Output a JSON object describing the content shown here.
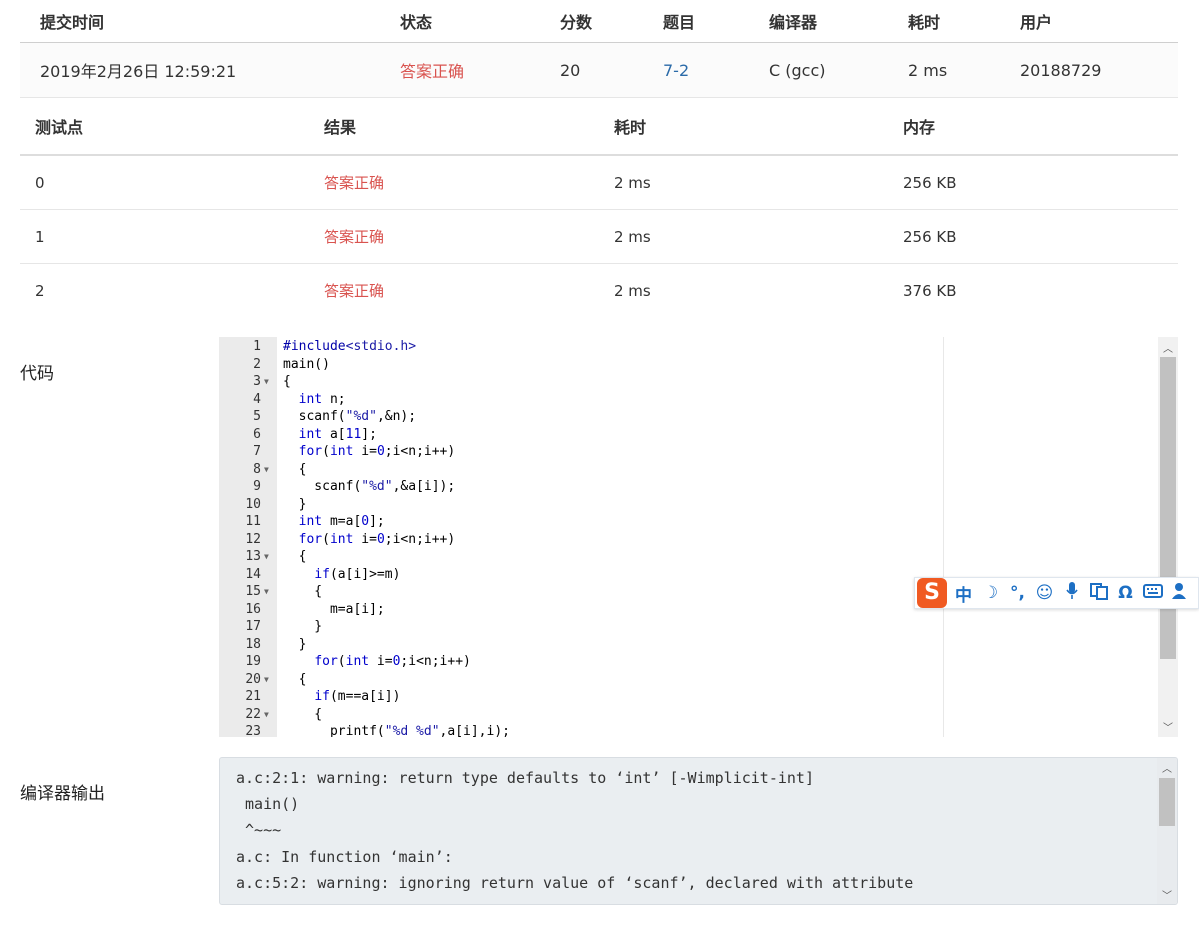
{
  "submission": {
    "headers": [
      "提交时间",
      "状态",
      "分数",
      "题目",
      "编译器",
      "耗时",
      "用户"
    ],
    "row": {
      "time": "2019年2月26日 12:59:21",
      "status": "答案正确",
      "score": "20",
      "problem": "7-2",
      "compiler": "C (gcc)",
      "elapsed": "2 ms",
      "user": "20188729"
    }
  },
  "testcases": {
    "headers": [
      "测试点",
      "结果",
      "耗时",
      "内存"
    ],
    "rows": [
      {
        "id": "0",
        "result": "答案正确",
        "time": "2 ms",
        "memory": "256 KB"
      },
      {
        "id": "1",
        "result": "答案正确",
        "time": "2 ms",
        "memory": "256 KB"
      },
      {
        "id": "2",
        "result": "答案正确",
        "time": "2 ms",
        "memory": "376 KB"
      }
    ]
  },
  "code_label": "代码",
  "code_lines": [
    "#include<stdio.h>",
    "main()",
    "{",
    "  int n;",
    "  scanf(\"%d\",&n);",
    "  int a[11];",
    "  for(int i=0;i<n;i++)",
    "  {",
    "    scanf(\"%d\",&a[i]);",
    "  }",
    "  int m=a[0];",
    "  for(int i=0;i<n;i++)",
    "  {",
    "    if(a[i]>=m)",
    "    {",
    "      m=a[i];",
    "    }",
    "  }",
    "    for(int i=0;i<n;i++)",
    "  {",
    "    if(m==a[i])",
    "    {",
    "      printf(\"%d %d\",a[i],i);"
  ],
  "fold_lines": [
    3,
    8,
    13,
    15,
    20,
    22
  ],
  "output_label": "编译器输出",
  "output_lines": [
    "a.c:2:1: warning: return type defaults to ‘int’ [-Wimplicit-int]",
    " main()",
    " ^~~~",
    "a.c: In function ‘main’:",
    "a.c:5:2: warning: ignoring return value of ‘scanf’, declared with attribute"
  ],
  "ime": {
    "logo": "S",
    "items": [
      "中",
      "☽",
      "°,",
      "☺",
      "mic-icon",
      "tools-icon",
      "Ω",
      "keyboard-icon",
      "user-icon"
    ]
  },
  "colors": {
    "accepted": "#d9534f",
    "link": "#2a6aa8",
    "gutter": "#ebebeb",
    "output_bg": "#eaeef1"
  }
}
